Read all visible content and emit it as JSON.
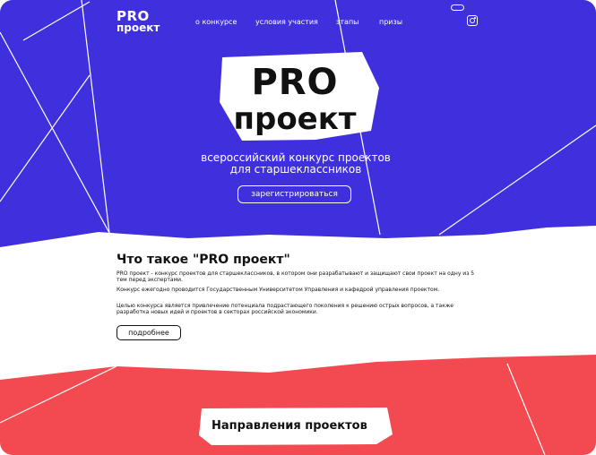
{
  "colors": {
    "blue": "#3f2fdc",
    "red": "#f24a50",
    "white": "#ffffff",
    "text": "#111111"
  },
  "header": {
    "logo_line1": "PRO",
    "logo_line2": "проект",
    "nav": [
      "о конкурсе",
      "условия участия",
      "этапы",
      "призы"
    ],
    "icons": [
      "toggle-icon",
      "instagram-icon"
    ]
  },
  "hero": {
    "title_line1": "PRO",
    "title_line2": "проект",
    "subtitle_line1": "всероссийский конкурс проектов",
    "subtitle_line2": "для старшеклассников",
    "register_label": "зарегистрироваться"
  },
  "about": {
    "heading": "Что такое \"PRO проект\"",
    "p1": "PRO проект - конкурс проектов для старшеклассников, в котором они разрабатывают и защищают свои проект на одну из 5 тем перед экспертами.",
    "p2": "Конкурс ежегодно проводится Государственным Университетом Управления и кафедрой управления проектом.",
    "p3": "Целью конкурса является привлечение потенциала подрастающего поколения к решению острых вопросов, а также разработка новых идей и проектов в секторах российской экономики.",
    "more_label": "подробнее"
  },
  "directions": {
    "heading": "Направления проектов"
  }
}
